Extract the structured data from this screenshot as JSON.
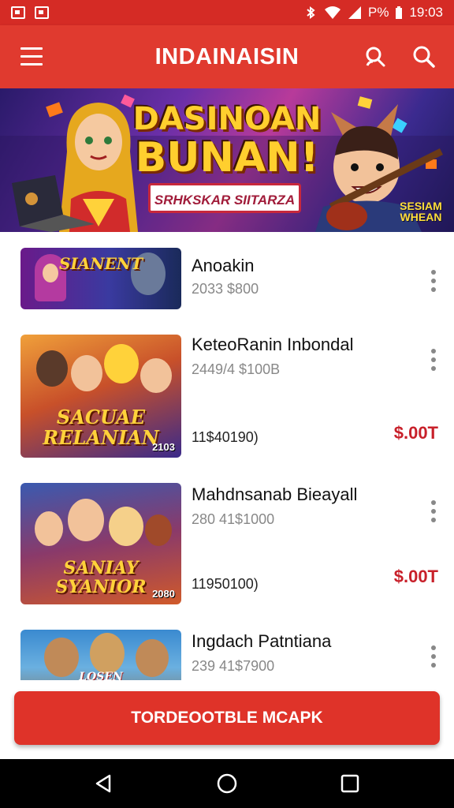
{
  "status_bar": {
    "battery_text": "P%",
    "time": "19:03"
  },
  "app_bar": {
    "title": "INDAINAISIN"
  },
  "banner": {
    "title_line1": "DASINOAN",
    "title_line2": "BUNAN!",
    "ribbon": "SRHKSKAR SIITARZA",
    "corner_text": "SESIAM WHEAN"
  },
  "list": [
    {
      "title": "Anoakin",
      "subtitle": "2033 $800",
      "extra": "",
      "price": "",
      "thumb_text": "SIANENT"
    },
    {
      "title": "KeteoRanin Inbondal",
      "subtitle": "2449/4 $100B",
      "extra": "11$40190)",
      "price": "$.00T",
      "thumb_text": "SACUAE RELANIAN",
      "thumb_year": "2103"
    },
    {
      "title": "Mahdnsanab Bieayall",
      "subtitle": "280 41$1000",
      "extra": "11950100)",
      "price": "$.00T",
      "thumb_text": "SANIAY SYANIOR",
      "thumb_year": "2080"
    },
    {
      "title": "Ingdach Patntiana",
      "subtitle": "239 41$7900",
      "extra": "",
      "price": "",
      "thumb_text": "LOSEN"
    }
  ],
  "cta": {
    "label": "TORDEOOTBLE MCAPK"
  },
  "colors": {
    "primary": "#e03a2f",
    "status": "#d52b25",
    "price": "#c8202a"
  }
}
